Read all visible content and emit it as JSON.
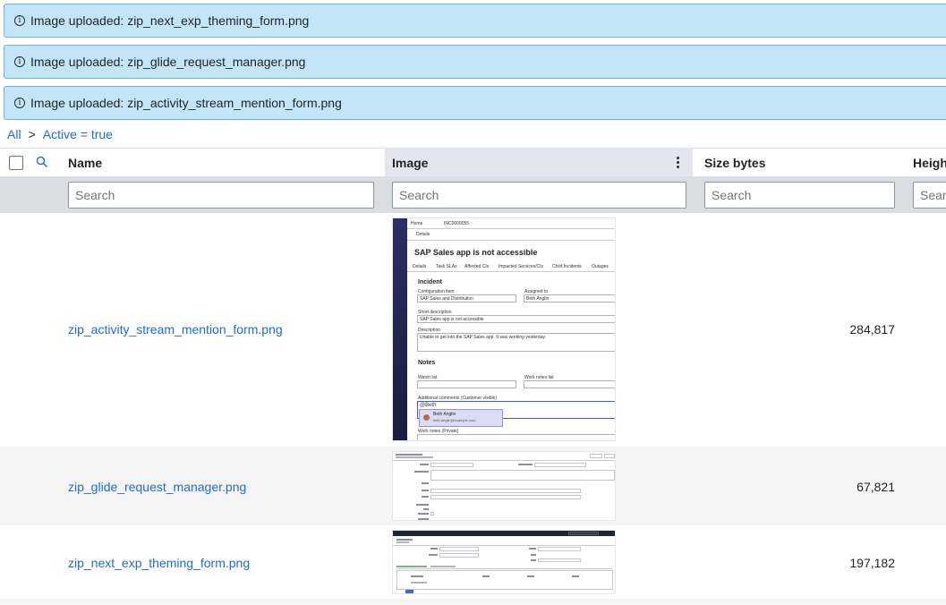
{
  "notifications": [
    {
      "text": "Image uploaded: zip_next_exp_theming_form.png"
    },
    {
      "text": "Image uploaded: zip_glide_request_manager.png"
    },
    {
      "text": "Image uploaded: zip_activity_stream_mention_form.png"
    }
  ],
  "breadcrumb": {
    "all": "All",
    "separator": ">",
    "filter": "Active = true"
  },
  "columns": [
    {
      "label": "Name"
    },
    {
      "label": "Image"
    },
    {
      "label": "Size bytes"
    },
    {
      "label": "Heigh"
    }
  ],
  "filter_placeholder": "Search",
  "rows": [
    {
      "name": "zip_activity_stream_mention_form.png",
      "size": "284,817",
      "thumbnail": {
        "tab_home": "Home",
        "tab_record": "INC0000055",
        "details_tab": "Details",
        "title": "SAP Sales app is not accessible",
        "subtabs": [
          "Details",
          "Task SLAs",
          "Affected CIs",
          "Impacted Services/CIs",
          "Child Incidents",
          "Outages"
        ],
        "section_incident": "Incident",
        "label_ci": "Configuration item",
        "value_ci": "SAP Sales and Distribution",
        "label_assigned": "Assigned to",
        "value_assigned": "Beth Anglin",
        "label_short_desc": "Short description",
        "value_short_desc": "SAP Sales app is not accessible",
        "label_desc": "Description",
        "value_desc": "Unable to get into the SAP Sales app. It was working yesterday.",
        "section_notes": "Notes",
        "label_watch": "Watch list",
        "label_worknotes_list": "Work notes list",
        "label_additional": "Additional comments (Customer visible)",
        "value_additional": "@Beth",
        "mention_name": "Beth Anglin",
        "mention_email": "beth.anglin@example.com",
        "label_worknotes": "Work notes (Private)"
      }
    },
    {
      "name": "zip_glide_request_manager.png",
      "size": "67,821"
    },
    {
      "name": "zip_next_exp_theming_form.png",
      "size": "197,182"
    }
  ],
  "colors": {
    "banner_bg": "#c4e5f7",
    "link": "#1f6ad3",
    "filter_row_bg": "#dadde1",
    "image_header_bg": "#e4e6ef"
  }
}
